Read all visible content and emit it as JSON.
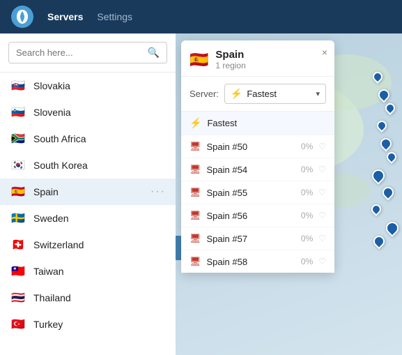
{
  "header": {
    "logo_alt": "NordVPN Logo",
    "nav": [
      {
        "label": "Servers",
        "active": true
      },
      {
        "label": "Settings",
        "active": false
      }
    ]
  },
  "sidebar": {
    "search": {
      "placeholder": "Search here...",
      "icon": "🔍"
    },
    "countries": [
      {
        "name": "Slovakia",
        "flag": "🇸🇰",
        "selected": false
      },
      {
        "name": "Slovenia",
        "flag": "🇸🇮",
        "selected": false
      },
      {
        "name": "South Africa",
        "flag": "🇿🇦",
        "selected": false
      },
      {
        "name": "South Korea",
        "flag": "🇰🇷",
        "selected": false
      },
      {
        "name": "Spain",
        "flag": "🇪🇸",
        "selected": true
      },
      {
        "name": "Sweden",
        "flag": "🇸🇪",
        "selected": false
      },
      {
        "name": "Switzerland",
        "flag": "🇨🇭",
        "selected": false
      },
      {
        "name": "Taiwan",
        "flag": "🇹🇼",
        "selected": false
      },
      {
        "name": "Thailand",
        "flag": "🇹🇭",
        "selected": false
      },
      {
        "name": "Turkey",
        "flag": "🇹🇷",
        "selected": false
      }
    ]
  },
  "spain_panel": {
    "flag": "🇪🇸",
    "name": "Spain",
    "region": "1 region",
    "server_label": "Server:",
    "selected_server": "Fastest",
    "close_label": "×",
    "servers": [
      {
        "name": "Fastest",
        "type": "fastest",
        "pct": "",
        "icon": "bolt"
      },
      {
        "name": "Spain #50",
        "type": "server",
        "pct": "0%",
        "icon": "server"
      },
      {
        "name": "Spain #54",
        "type": "server",
        "pct": "0%",
        "icon": "server"
      },
      {
        "name": "Spain #55",
        "type": "server",
        "pct": "0%",
        "icon": "server"
      },
      {
        "name": "Spain #56",
        "type": "server",
        "pct": "0%",
        "icon": "server"
      },
      {
        "name": "Spain #57",
        "type": "server",
        "pct": "0%",
        "icon": "server"
      },
      {
        "name": "Spain #58",
        "type": "server",
        "pct": "0%",
        "icon": "server"
      }
    ]
  }
}
